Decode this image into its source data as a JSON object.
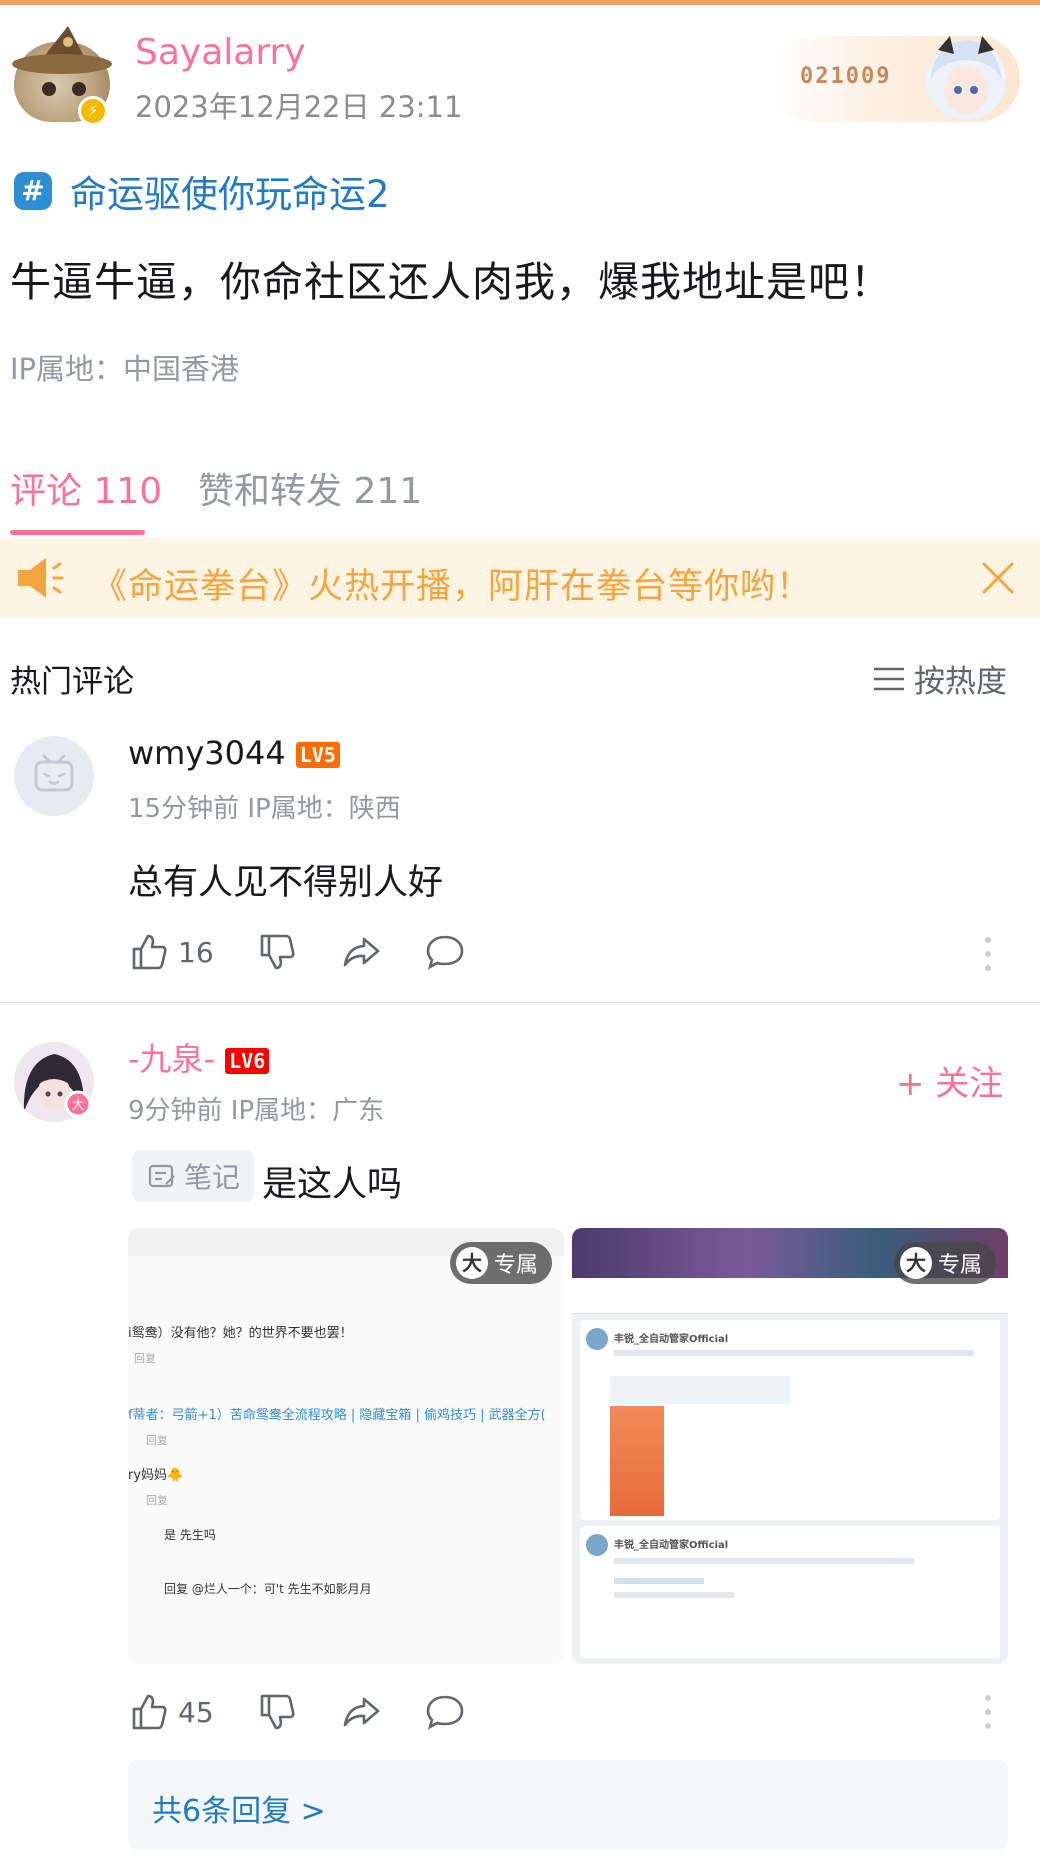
{
  "post": {
    "author": "Sayalarry",
    "time": "2023年12月22日 23:11",
    "fan_number": "021009",
    "topic": "命运驱使你玩命运2",
    "body": "牛逼牛逼，你命社区还人肉我，爆我地址是吧！",
    "ip": "IP属地：中国香港"
  },
  "tabs": {
    "comments": "评论 110",
    "likes": "赞和转发 211"
  },
  "notice": {
    "text": "《命运拳台》火热开播，阿肝在拳台等你哟！"
  },
  "comments_header": {
    "title": "热门评论",
    "sort": "按热度"
  },
  "comments": [
    {
      "name": "wmy3044",
      "level": "LV5",
      "meta": "15分钟前  IP属地：陕西",
      "text": "总有人见不得别人好",
      "likes": "16"
    },
    {
      "name": "-九泉-",
      "level": "LV6",
      "meta": "9分钟前  IP属地：广东",
      "follow": "+ 关注",
      "note_label": "笔记",
      "text": "是这人吗",
      "likes": "45",
      "replies": "共6条回复 >"
    }
  ],
  "images": {
    "exclusive_badge": "大",
    "exclusive_label": "专属",
    "left": {
      "lines": [
        "i鸳鸯）没有他？她？的世界不要也罢！",
        "回复",
        "f蒂者：弓箭+1）苦命鸳鸯全流程攻略 | 隐藏宝箱 | 偷鸡技巧 | 武器全方(",
        "回复",
        "ry妈妈🐥",
        "回复",
        "是        先生吗",
        "回复 @烂人一个：可't   先生不如影月月"
      ]
    },
    "right": {
      "card1_title": "丰锐_全自动管家Official",
      "card2_title": "丰锐_全自动管家Official"
    }
  },
  "colors": {
    "accent": "#fb7299",
    "link": "#1f7ac8",
    "notice": "#f6a53e",
    "lv5": "#ff6c00",
    "lv6": "#ff0000"
  }
}
